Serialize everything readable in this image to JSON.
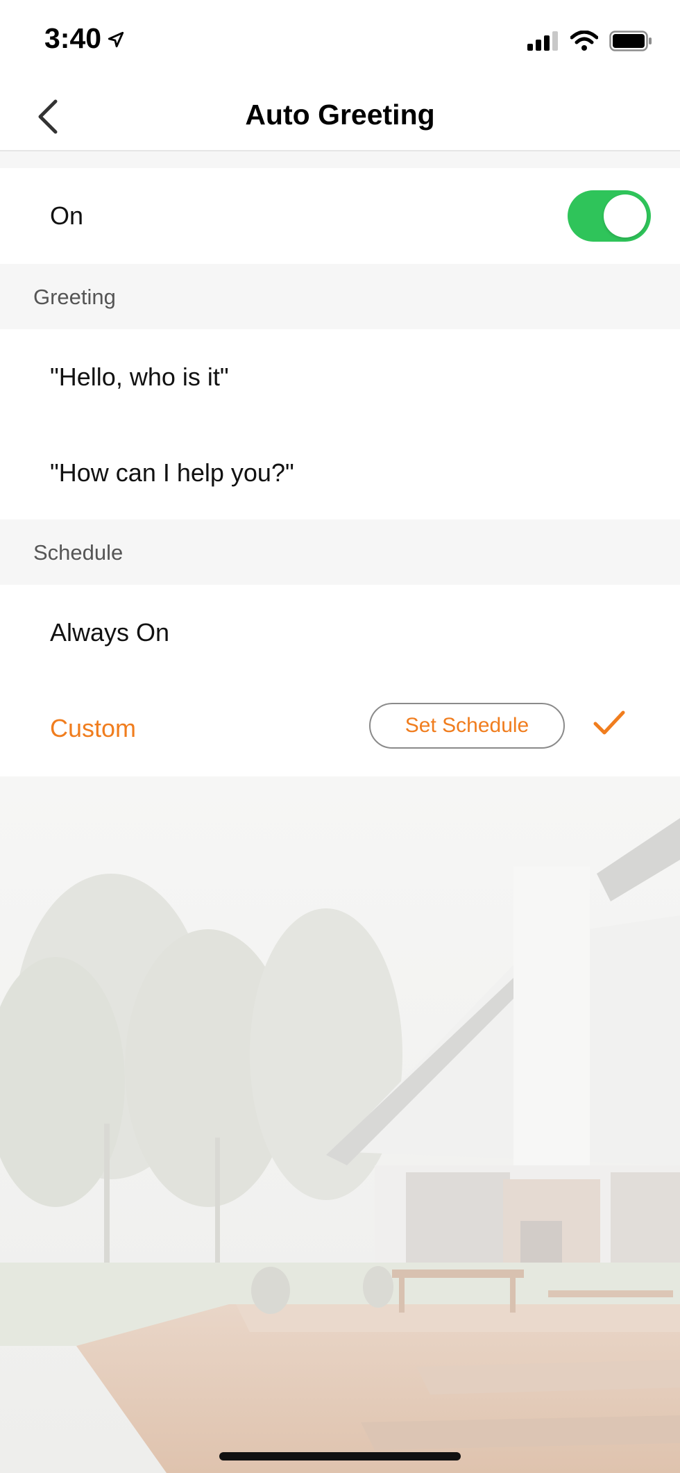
{
  "status_bar": {
    "time": "3:40"
  },
  "header": {
    "title": "Auto Greeting"
  },
  "toggle_row": {
    "label": "On",
    "enabled": true,
    "on_color": "#2fc45a"
  },
  "greeting_section": {
    "header": "Greeting",
    "options": [
      "\"Hello, who is it\"",
      "\"How can I help you?\""
    ]
  },
  "schedule_section": {
    "header": "Schedule",
    "always_on_label": "Always On",
    "custom_label": "Custom",
    "set_schedule_label": "Set Schedule",
    "selected": "Custom"
  },
  "colors": {
    "accent": "#f07d1e",
    "section_bg": "#f6f6f6"
  }
}
